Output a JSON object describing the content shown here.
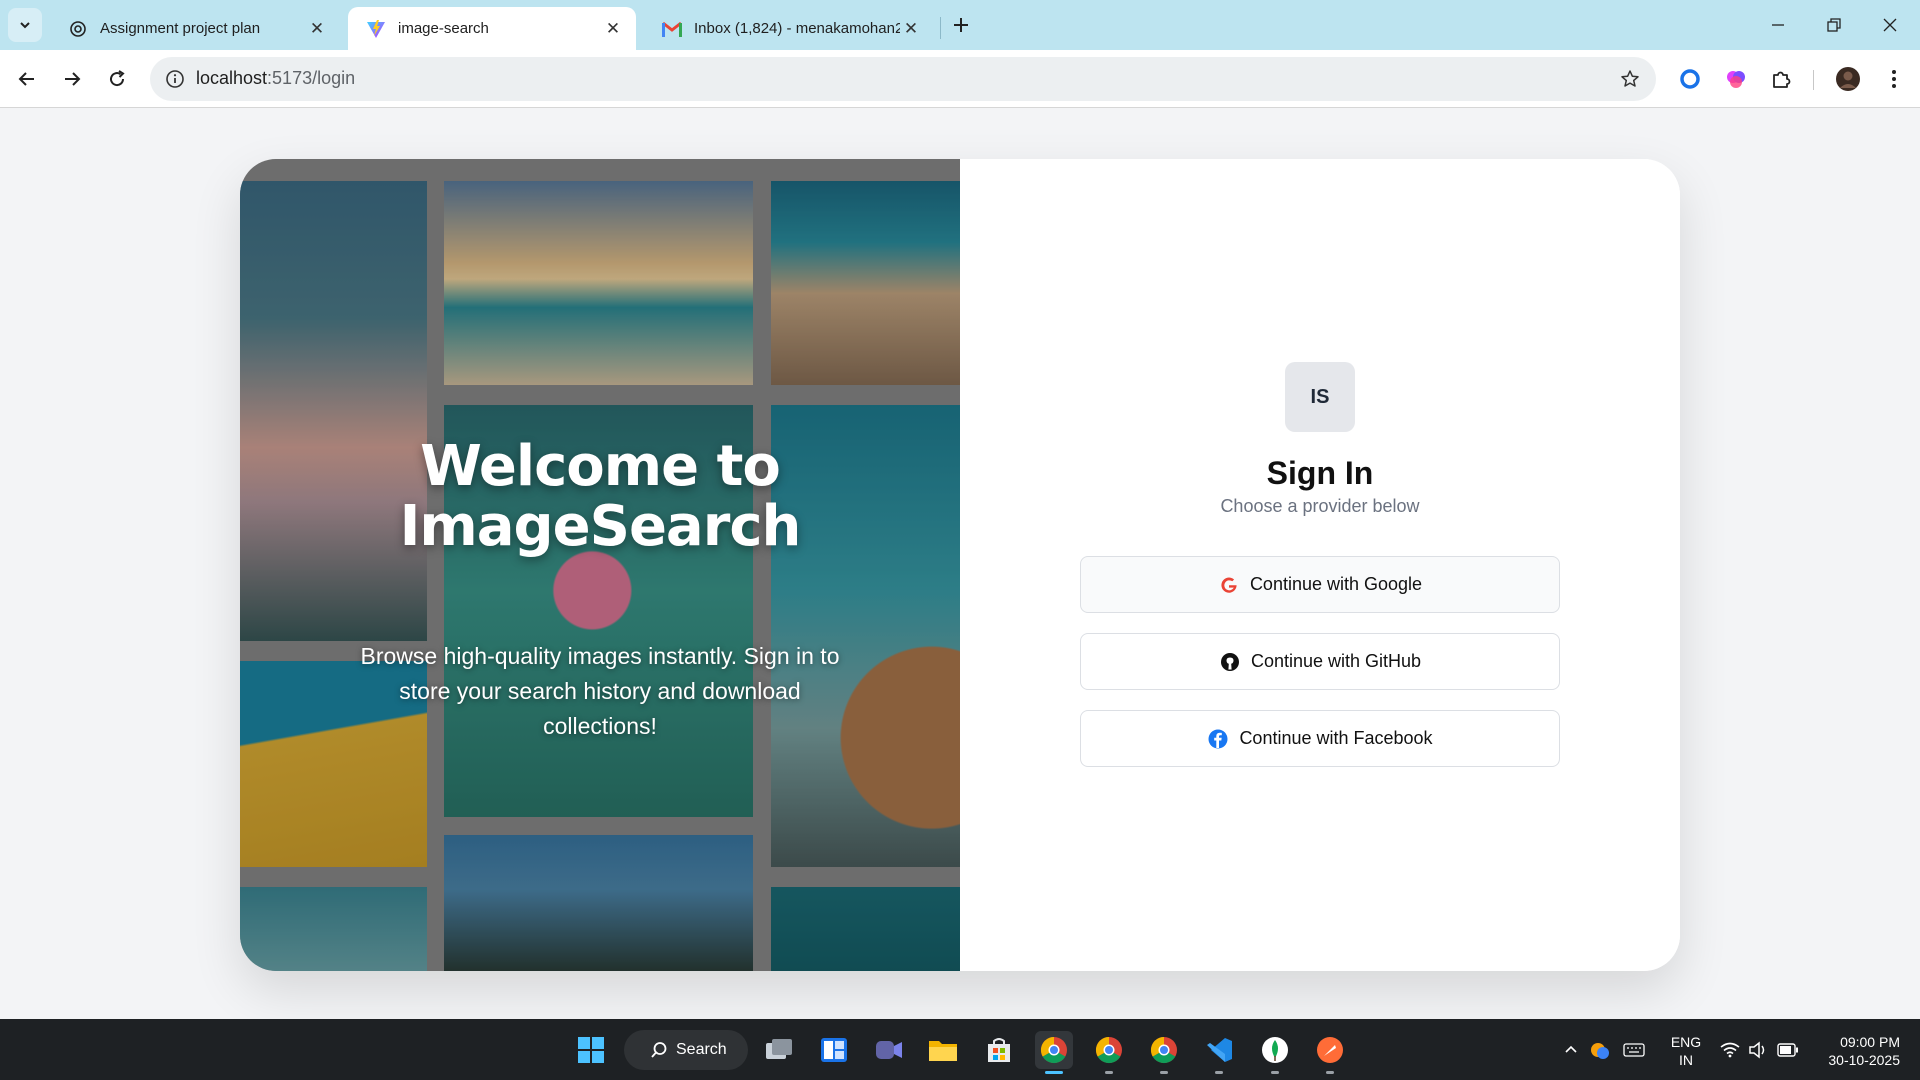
{
  "tabs": [
    {
      "title": "Assignment project plan",
      "icon": "openai-icon",
      "active": false
    },
    {
      "title": "image-search",
      "icon": "vite-icon",
      "active": true
    },
    {
      "title": "Inbox (1,824) - menakamohan2",
      "icon": "gmail-icon",
      "active": false
    }
  ],
  "address_bar": {
    "host": "localhost",
    "path": ":5173/login"
  },
  "hero": {
    "title_line1": "Welcome to",
    "title_line2": "ImageSearch",
    "subtitle": "Browse high-quality images instantly. Sign in to store your search history and download collections!"
  },
  "login": {
    "logo_text": "IS",
    "title": "Sign In",
    "subtitle": "Choose a provider below",
    "providers": [
      {
        "label": "Continue with Google",
        "icon": "google-icon",
        "color": "#ea4335"
      },
      {
        "label": "Continue with GitHub",
        "icon": "github-icon",
        "color": "#111111"
      },
      {
        "label": "Continue with Facebook",
        "icon": "facebook-icon",
        "color": "#1877f2"
      }
    ]
  },
  "taskbar": {
    "search_label": "Search",
    "language_line1": "ENG",
    "language_line2": "IN",
    "time": "09:00 PM",
    "date": "30-10-2025"
  },
  "colors": {
    "accent": "#4cc2ff",
    "tab_strip": "#bde4f0",
    "page_bg": "#f3f4f6"
  }
}
